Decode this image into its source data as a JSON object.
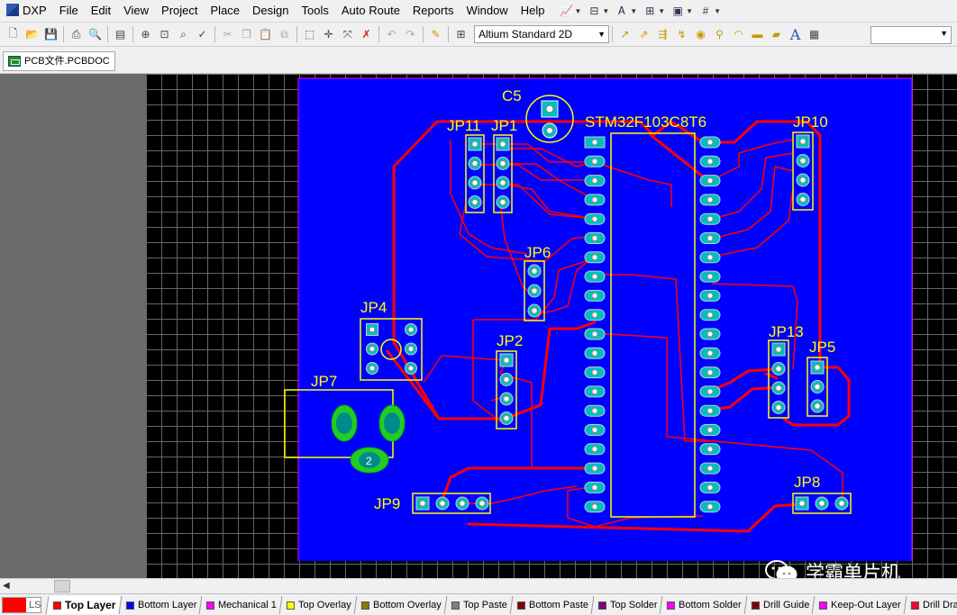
{
  "menubar": {
    "logo_label": "DXP",
    "items": [
      "File",
      "Edit",
      "View",
      "Project",
      "Place",
      "Design",
      "Tools",
      "Auto Route",
      "Reports",
      "Window",
      "Help"
    ]
  },
  "toolbar": {
    "view_mode": "Altium Standard 2D"
  },
  "document": {
    "tab_label": "PCB文件.PCBDOC"
  },
  "components": {
    "c5": "C5",
    "mcu": "STM32F103C8T6",
    "jp11": "JP11",
    "jp1": "JP1",
    "jp10": "JP10",
    "jp6": "JP6",
    "jp4": "JP4",
    "jp2": "JP2",
    "jp7": "JP7",
    "jp13": "JP13",
    "jp5": "JP5",
    "jp8": "JP8",
    "jp9": "JP9",
    "jp7_pad_label": "2"
  },
  "layers": {
    "current_label": "LS",
    "tabs": [
      {
        "name": "Top Layer",
        "color": "#ff0000"
      },
      {
        "name": "Bottom Layer",
        "color": "#0000ff"
      },
      {
        "name": "Mechanical 1",
        "color": "#ff00ff"
      },
      {
        "name": "Top Overlay",
        "color": "#ffff00"
      },
      {
        "name": "Bottom Overlay",
        "color": "#808000"
      },
      {
        "name": "Top Paste",
        "color": "#808080"
      },
      {
        "name": "Bottom Paste",
        "color": "#800000"
      },
      {
        "name": "Top Solder",
        "color": "#800080"
      },
      {
        "name": "Bottom Solder",
        "color": "#ff00ff"
      },
      {
        "name": "Drill Guide",
        "color": "#800000"
      },
      {
        "name": "Keep-Out Layer",
        "color": "#ff00ff"
      },
      {
        "name": "Drill Drawing",
        "color": "#ff002a"
      }
    ]
  },
  "watermark": {
    "text": "学霸单片机"
  },
  "colors": {
    "board": "#0000ff",
    "trace": "#ff0000",
    "overlay": "#ffff00",
    "pad": "#008b8b"
  }
}
